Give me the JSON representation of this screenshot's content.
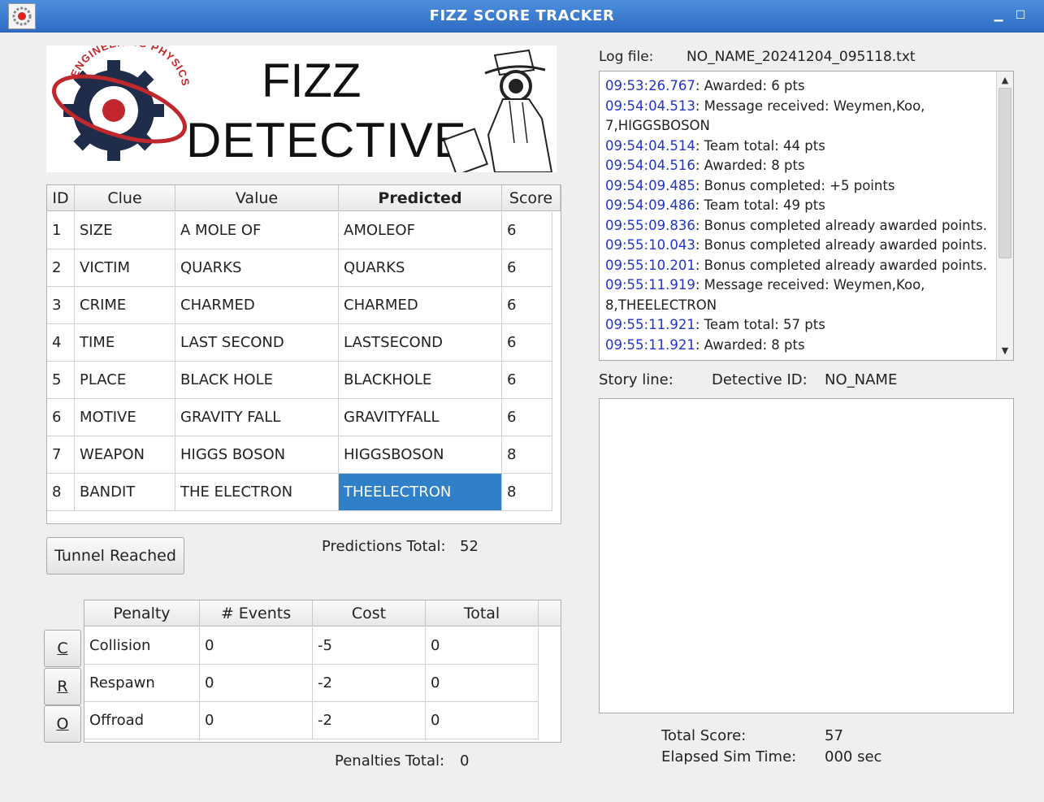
{
  "window": {
    "title": "FIZZ SCORE TRACKER"
  },
  "banner": {
    "logo_text": "ENGINEERING PHYSICS",
    "title_line1": "FIZZ",
    "title_line2": "DETECTIVE"
  },
  "clue_table": {
    "headers": [
      "ID",
      "Clue",
      "Value",
      "Predicted",
      "Score"
    ],
    "rows": [
      {
        "id": "1",
        "clue": "SIZE",
        "value": "A MOLE OF",
        "predicted": "AMOLEOF",
        "score": "6"
      },
      {
        "id": "2",
        "clue": "VICTIM",
        "value": "QUARKS",
        "predicted": "QUARKS",
        "score": "6"
      },
      {
        "id": "3",
        "clue": "CRIME",
        "value": "CHARMED",
        "predicted": "CHARMED",
        "score": "6"
      },
      {
        "id": "4",
        "clue": "TIME",
        "value": "LAST SECOND",
        "predicted": "LASTSECOND",
        "score": "6"
      },
      {
        "id": "5",
        "clue": "PLACE",
        "value": "BLACK HOLE",
        "predicted": "BLACKHOLE",
        "score": "6"
      },
      {
        "id": "6",
        "clue": "MOTIVE",
        "value": "GRAVITY FALL",
        "predicted": "GRAVITYFALL",
        "score": "6"
      },
      {
        "id": "7",
        "clue": "WEAPON",
        "value": "HIGGS BOSON",
        "predicted": "HIGGSBOSON",
        "score": "8"
      },
      {
        "id": "8",
        "clue": "BANDIT",
        "value": "THE ELECTRON",
        "predicted": "THEELECTRON",
        "score": "8"
      }
    ]
  },
  "tunnel_button": {
    "label": "Tunnel Reached"
  },
  "predictions_total": {
    "label": "Predictions Total:",
    "value": "52"
  },
  "penalty_table": {
    "headers": [
      "Penalty",
      "# Events",
      "Cost",
      "Total"
    ],
    "rows": [
      {
        "button": "C",
        "penalty": "Collision",
        "events": "0",
        "cost": "-5",
        "total": "0"
      },
      {
        "button": "R",
        "penalty": "Respawn",
        "events": "0",
        "cost": "-2",
        "total": "0"
      },
      {
        "button": "O",
        "penalty": "Offroad",
        "events": "0",
        "cost": "-2",
        "total": "0"
      }
    ]
  },
  "penalties_total": {
    "label": "Penalties Total:",
    "value": "0"
  },
  "log": {
    "label": "Log file:",
    "filename": "NO_NAME_20241204_095118.txt",
    "lines": [
      {
        "ts": "09:53:26.767",
        "msg": ": Awarded: 6 pts"
      },
      {
        "ts": "09:54:04.513",
        "msg": ": Message received: Weymen,Koo,"
      },
      {
        "ts": "",
        "msg": "7,HIGGSBOSON"
      },
      {
        "ts": "09:54:04.514",
        "msg": ": Team total: 44 pts"
      },
      {
        "ts": "09:54:04.516",
        "msg": ": Awarded: 8 pts"
      },
      {
        "ts": "09:54:09.485",
        "msg": ": Bonus completed: +5 points"
      },
      {
        "ts": "09:54:09.486",
        "msg": ": Team total: 49 pts"
      },
      {
        "ts": "09:55:09.836",
        "msg": ": Bonus completed already awarded points."
      },
      {
        "ts": "09:55:10.043",
        "msg": ": Bonus completed already awarded points."
      },
      {
        "ts": "09:55:10.201",
        "msg": ": Bonus completed already awarded points."
      },
      {
        "ts": "09:55:11.919",
        "msg": ": Message received: Weymen,Koo,"
      },
      {
        "ts": "",
        "msg": "8,THEELECTRON"
      },
      {
        "ts": "09:55:11.921",
        "msg": ": Team total: 57 pts"
      },
      {
        "ts": "09:55:11.921",
        "msg": ": Awarded: 8 pts"
      }
    ]
  },
  "story": {
    "label": "Story line:",
    "detective_label": "Detective ID:",
    "detective_id": "NO_NAME"
  },
  "summary": {
    "total_score_label": "Total Score:",
    "total_score": "57",
    "elapsed_label": "Elapsed Sim Time:",
    "elapsed": "000 sec"
  },
  "colors": {
    "titlebar": "#2e6cc4",
    "selection": "#2f80c8",
    "timestamp": "#2233c8"
  }
}
